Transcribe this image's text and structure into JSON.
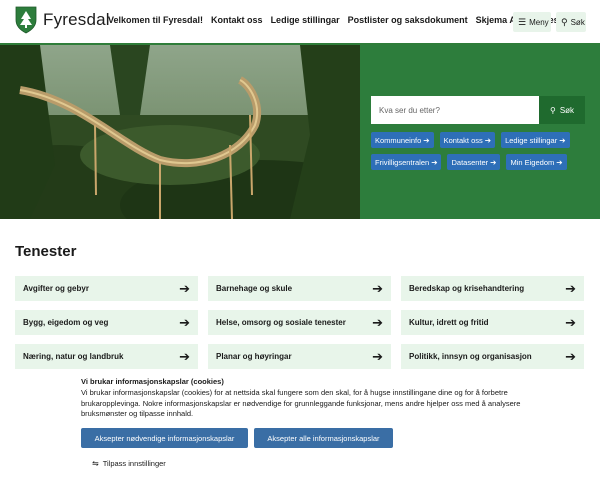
{
  "header": {
    "site_name": "Fyresdal",
    "nav": [
      "Velkomen til Fyresdal!",
      "Kontakt oss",
      "Ledige stillingar",
      "Postlister og saksdokument",
      "Skjema A-Å",
      "Tenester"
    ],
    "menu_label": "Meny",
    "search_label": "Søk",
    "icons": {
      "logo": "coat-of-arms-icon",
      "menu": "hamburger-icon",
      "search": "magnifier-icon"
    }
  },
  "hero": {
    "search": {
      "placeholder": "Kva ser du etter?",
      "button_label": "Søk"
    },
    "quick_links": [
      "Kommuneinfo",
      "Kontakt oss",
      "Ledige stillingar",
      "Frivilligsentralen",
      "Datasenter",
      "Min Eigedom"
    ]
  },
  "services": {
    "title": "Tenester",
    "items": [
      "Avgifter og gebyr",
      "Barnehage og skule",
      "Beredskap og krisehandtering",
      "Bygg, eigedom og veg",
      "Helse, omsorg og sosiale tenester",
      "Kultur, idrett og fritid",
      "Næring, natur og landbruk",
      "Planar og høyringar",
      "Politikk, innsyn og organisasjon"
    ]
  },
  "cookie": {
    "title": "Vi brukar informasjonskapslar (cookies)",
    "text": "Vi brukar informasjonskapslar (cookies) for at nettsida skal fungere som den skal, for å hugse innstillingane dine og for å forbetre brukaropplevinga. Nokre informasjonskapslar er nødvendige for grunnleggande funksjonar, mens andre hjelper oss med å analysere bruksmønster og tilpasse innhald.",
    "accept_necessary": "Aksepter nødvendige informasjonskapslar",
    "accept_all": "Aksepter alle informasjonskapslar",
    "customize": "Tilpass innstillinger"
  },
  "colors": {
    "brand_green": "#2d7d3c",
    "tile_bg": "#e8f5ea",
    "link_blue": "#2e6fb8",
    "button_blue": "#3a6ea5"
  }
}
